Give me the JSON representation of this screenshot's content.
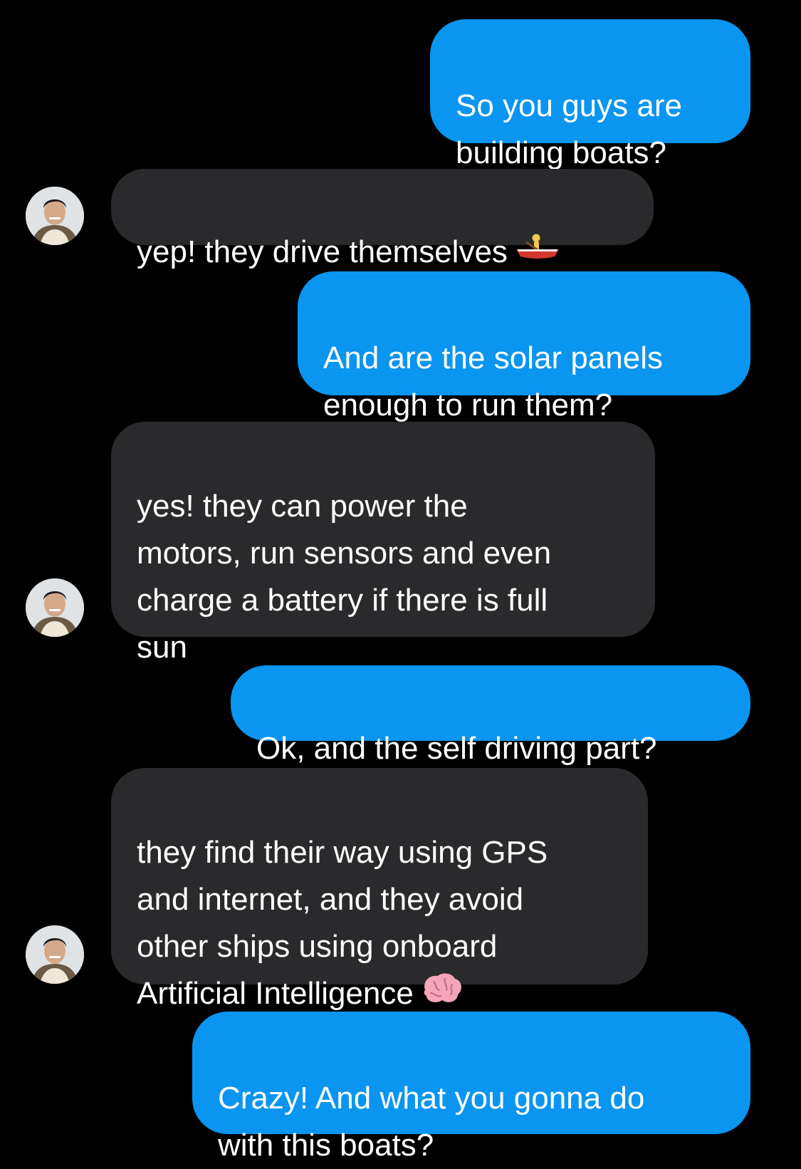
{
  "conversation": {
    "messages": [
      {
        "direction": "outgoing",
        "text": "So you guys are\nbuilding boats?"
      },
      {
        "direction": "incoming",
        "text": "yep! they drive themselves",
        "emoji": "rowboat"
      },
      {
        "direction": "outgoing",
        "text": "And are the solar panels\nenough to run them?"
      },
      {
        "direction": "incoming",
        "text": "yes! they can power the\nmotors, run sensors and even\ncharge a battery if there is full\nsun"
      },
      {
        "direction": "outgoing",
        "text": "Ok, and the self driving part?"
      },
      {
        "direction": "incoming",
        "text": "they find their way using GPS\nand internet, and they avoid\nother ships using onboard\nArtificial Intelligence",
        "emoji": "brain"
      },
      {
        "direction": "outgoing",
        "text": "Crazy! And what you gonna do\nwith this boats?"
      }
    ]
  },
  "colors": {
    "background": "#000000",
    "outgoing_bubble": "#0a95f0",
    "incoming_bubble": "#2a2a2c",
    "text": "#ffffff"
  },
  "icons": {
    "avatar": "contact-avatar",
    "emoji_1": "rowboat-emoji",
    "emoji_2": "brain-emoji"
  }
}
